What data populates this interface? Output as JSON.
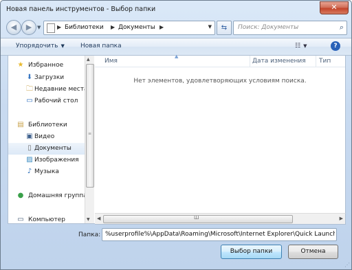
{
  "window": {
    "title": "Новая панель инструментов - Выбор папки",
    "close_glyph": "✕"
  },
  "nav": {
    "back_glyph": "◀",
    "forward_glyph": "▶",
    "breadcrumbs": [
      "Библиотеки",
      "Документы"
    ],
    "search_placeholder": "Поиск: Документы",
    "icons": [
      "back-icon",
      "forward-icon",
      "refresh-icon",
      "search-icon"
    ]
  },
  "toolbar": {
    "organize_label": "Упорядочить",
    "new_folder_label": "Новая папка",
    "view_glyph": "☷",
    "help_glyph": "?"
  },
  "sidebar": {
    "items": [
      {
        "label": "Избранное",
        "icon": "star-icon",
        "glyph": "★",
        "color": "#e8b82a",
        "group": true
      },
      {
        "label": "Загрузки",
        "icon": "downloads-icon",
        "glyph": "⬇",
        "color": "#3a78c2"
      },
      {
        "label": "Недавние места",
        "icon": "recent-places-icon",
        "glyph": "🗀",
        "color": "#c8a24a"
      },
      {
        "label": "Рабочий стол",
        "icon": "desktop-icon",
        "glyph": "▭",
        "color": "#2d6fbf"
      },
      {
        "label": "Библиотеки",
        "icon": "libraries-icon",
        "glyph": "▤",
        "color": "#c8a24a",
        "group": true
      },
      {
        "label": "Видео",
        "icon": "video-icon",
        "glyph": "▣",
        "color": "#3d5f8c"
      },
      {
        "label": "Документы",
        "icon": "documents-icon",
        "glyph": "▯",
        "color": "#6b6b6b",
        "selected": true
      },
      {
        "label": "Изображения",
        "icon": "pictures-icon",
        "glyph": "▨",
        "color": "#3a8bc2"
      },
      {
        "label": "Музыка",
        "icon": "music-icon",
        "glyph": "♪",
        "color": "#2a6db8"
      },
      {
        "label": "Домашняя группа",
        "icon": "homegroup-icon",
        "glyph": "●",
        "color": "#3aa04a",
        "group": true
      },
      {
        "label": "Компьютер",
        "icon": "computer-icon",
        "glyph": "▭",
        "color": "#4a5f7a",
        "group": true
      }
    ]
  },
  "file_list": {
    "columns": [
      "Имя",
      "Дата изменения",
      "Тип"
    ],
    "empty_message": "Нет элементов, удовлетворяющих условиям поиска."
  },
  "footer": {
    "folder_label": "Папка:",
    "folder_value": "%userprofile%\\AppData\\Roaming\\Microsoft\\Internet Explorer\\Quick Launch",
    "select_button": "Выбор папки",
    "cancel_button": "Отмена"
  }
}
